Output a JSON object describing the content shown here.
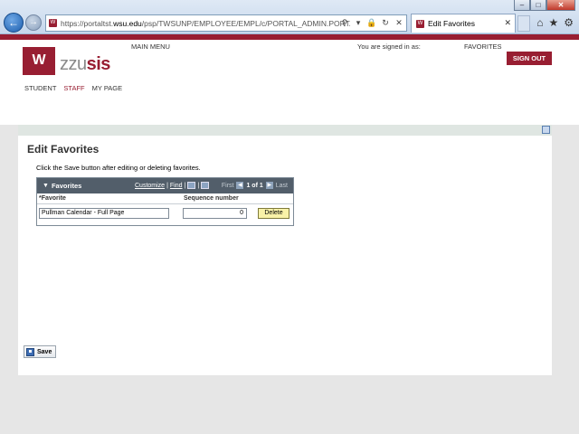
{
  "browser": {
    "url_prefix": "https://portaltst.",
    "url_domain": "wsu.edu",
    "url_rest": "/psp/TWSUNP/EMPLOYEE/EMPL/c/PORTAL_ADMIN.PORTAL_EDIT_F",
    "tab_title": "Edit Favorites",
    "window_buttons": [
      "–",
      "□",
      "✕"
    ]
  },
  "header": {
    "logo_mark": "W",
    "logo_prefix": "zzu",
    "logo_suffix": "sis",
    "main_menu": "MAIN MENU",
    "signed_in_as": "You are signed in as:",
    "favorites": "FAVORITES",
    "sign_out": "SIGN OUT",
    "nav": [
      "STUDENT",
      "STAFF",
      "MY PAGE"
    ]
  },
  "page": {
    "title": "Edit Favorites",
    "instructions": "Click the Save button after editing or deleting favorites.",
    "grid": {
      "title": "Favorites",
      "customize": "Customize",
      "find": "Find",
      "first": "First",
      "count": "1 of 1",
      "last": "Last",
      "columns": [
        "*Favorite",
        "Sequence number"
      ],
      "rows": [
        {
          "favorite": "Pullman Calendar - Full Page",
          "sequence": "0",
          "delete_label": "Delete"
        }
      ]
    },
    "save_label": "Save"
  },
  "colors": {
    "brand": "#981e32",
    "grid_header": "#525e6a",
    "delete_button": "#f9f2a8"
  }
}
